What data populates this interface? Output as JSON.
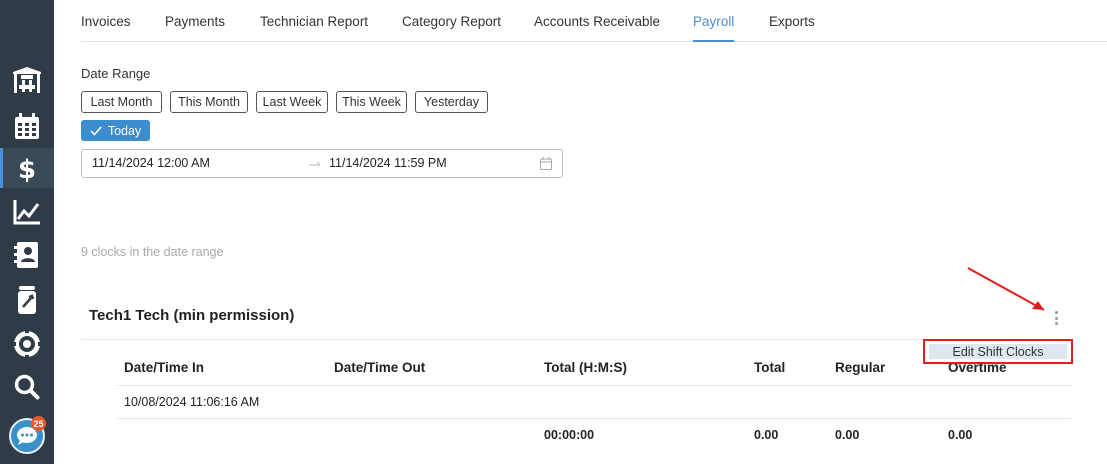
{
  "sidebar": {
    "items": [
      {
        "name": "shop-icon"
      },
      {
        "name": "calendar-icon"
      },
      {
        "name": "dollar-icon",
        "active": true
      },
      {
        "name": "chart-icon"
      },
      {
        "name": "contacts-icon"
      },
      {
        "name": "oil-can-icon"
      },
      {
        "name": "tire-icon"
      },
      {
        "name": "search-icon"
      }
    ],
    "chat_badge": "25"
  },
  "tabs": [
    "Invoices",
    "Payments",
    "Technician Report",
    "Category Report",
    "Accounts Receivable",
    "Payroll",
    "Exports"
  ],
  "active_tab": "Payroll",
  "date_range": {
    "label": "Date Range",
    "buttons": [
      "Last Month",
      "This Month",
      "Last Week",
      "This Week",
      "Yesterday"
    ],
    "today": "Today",
    "start": "11/14/2024 12:00 AM",
    "end": "11/14/2024 11:59 PM"
  },
  "clocks_info": "9 clocks in the date range",
  "technician": {
    "name": "Tech1 Tech (min permission)",
    "columns": [
      "Date/Time In",
      "Date/Time Out",
      "Total (H:M:S)",
      "Total",
      "Regular",
      "Overtime"
    ],
    "rows": [
      {
        "in": "10/08/2024 11:06:16 AM",
        "out": "",
        "total_hms": "",
        "total": "",
        "regular": "",
        "overtime": ""
      }
    ],
    "totals": {
      "total_hms": "00:00:00",
      "total": "0.00",
      "regular": "0.00",
      "overtime": "0.00"
    }
  },
  "context_menu": {
    "item": "Edit Shift Clocks"
  },
  "colors": {
    "accent": "#4a8fd4",
    "sidebar": "#2f3b46",
    "highlight": "#e01e1e"
  }
}
